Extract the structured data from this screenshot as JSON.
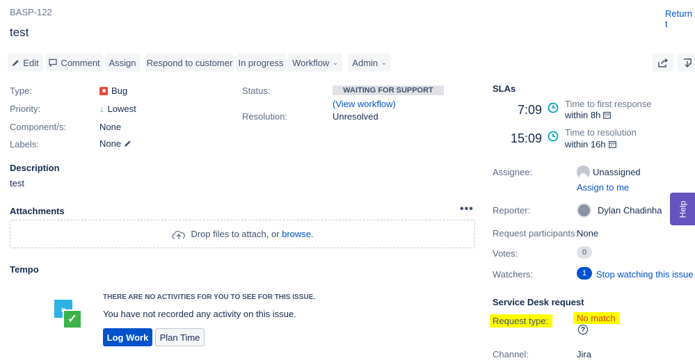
{
  "issue": {
    "key": "BASP-122",
    "summary": "test"
  },
  "return_link": "Return t",
  "toolbar": {
    "edit": "Edit",
    "comment": "Comment",
    "assign": "Assign",
    "respond": "Respond to customer",
    "in_progress": "In progress",
    "workflow": "Workflow",
    "admin": "Admin"
  },
  "details": {
    "type_label": "Type:",
    "type_value": "Bug",
    "priority_label": "Priority:",
    "priority_value": "Lowest",
    "component_label": "Component/s:",
    "component_value": "None",
    "labels_label": "Labels:",
    "labels_value": "None",
    "status_label": "Status:",
    "status_value": "WAITING FOR SUPPORT",
    "view_workflow_open": "(",
    "view_workflow": "View workflow",
    "view_workflow_close": ")",
    "resolution_label": "Resolution:",
    "resolution_value": "Unresolved"
  },
  "description": {
    "heading": "Description",
    "text": "test"
  },
  "attachments": {
    "heading": "Attachments",
    "drop_text": "Drop files to attach, or ",
    "browse": "browse",
    "period": "."
  },
  "tempo": {
    "heading": "Tempo",
    "title": "THERE ARE NO ACTIVITIES FOR YOU TO SEE FOR THIS ISSUE.",
    "message": "You have not recorded any activity on this issue.",
    "log_work": "Log Work",
    "plan_time": "Plan Time"
  },
  "slas": {
    "heading": "SLAs",
    "items": [
      {
        "time": "7:09",
        "label": "Time to first response",
        "within": "within 8h"
      },
      {
        "time": "15:09",
        "label": "Time to resolution",
        "within": "within 16h"
      }
    ]
  },
  "people": {
    "assignee_label": "Assignee:",
    "assignee_value": "Unassigned",
    "assign_to_me": "Assign to me",
    "reporter_label": "Reporter:",
    "reporter_value": "Dylan Chadinha",
    "participants_label": "Request participants:",
    "participants_value": "None",
    "votes_label": "Votes:",
    "votes_value": "0",
    "watchers_label": "Watchers:",
    "watchers_value": "1",
    "stop_watching": "Stop watching this issue"
  },
  "service_desk": {
    "heading": "Service Desk request",
    "request_type_label": "Request type:",
    "request_type_value": "No match",
    "channel_label": "Channel:",
    "channel_value": "Jira"
  },
  "help_tab": "Help",
  "colors": {
    "accent": "#0052cc",
    "help": "#6554c0",
    "highlight": "#ffff00",
    "no_match": "#de350b",
    "bug": "#e5493a",
    "success": "#36b37e"
  }
}
